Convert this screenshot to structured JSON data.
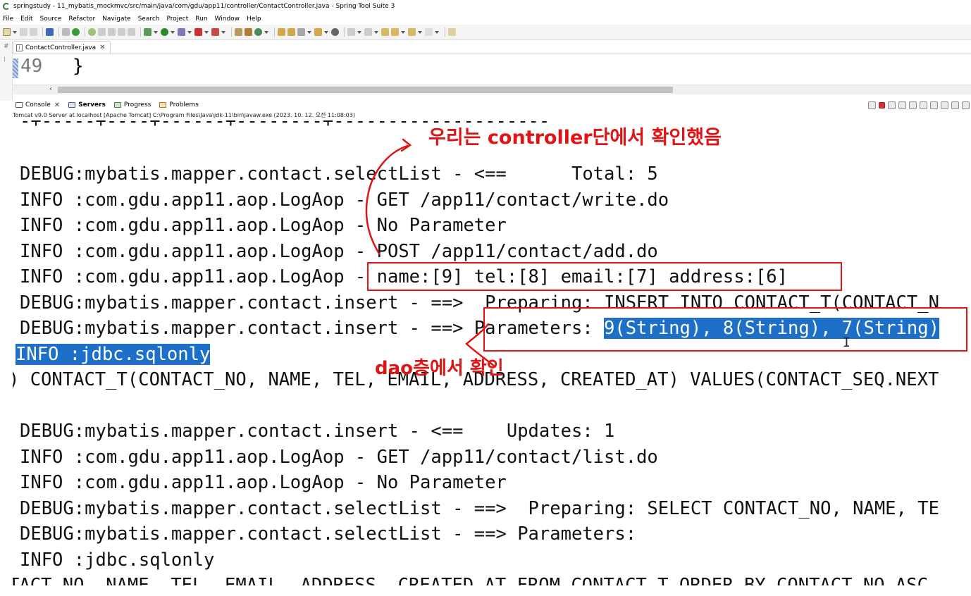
{
  "window": {
    "title": "springstudy - 11_mybatis_mockmvc/src/main/java/com/gdu/app11/controller/ContactController.java - Spring Tool Suite 3"
  },
  "menu": [
    "File",
    "Edit",
    "Source",
    "Refactor",
    "Navigate",
    "Search",
    "Project",
    "Run",
    "Window",
    "Help"
  ],
  "editor": {
    "tab_label": "ContactController.java",
    "line_number": "49",
    "code": "}"
  },
  "console": {
    "tabs": [
      {
        "label": "Console",
        "icon": "console-icon"
      },
      {
        "label": "Servers",
        "icon": "servers-icon"
      },
      {
        "label": "Progress",
        "icon": "progress-icon"
      },
      {
        "label": "Problems",
        "icon": "problems-icon"
      }
    ],
    "process_path": "Tomcat v9.0 Server at localhost [Apache Tomcat] C:\\Program Files\\Java\\jdk-11\\bin\\javaw.exe  (2023. 10. 12. 오전 11:08:03)",
    "lines": [
      "-+-----+----+------+--------+--------------------",
      "DEBUG:mybatis.mapper.contact.selectList - <==      Total: 5",
      "INFO :com.gdu.app11.aop.LogAop - GET /app11/contact/write.do",
      "INFO :com.gdu.app11.aop.LogAop - No Parameter",
      "INFO :com.gdu.app11.aop.LogAop - POST /app11/contact/add.do",
      "INFO :com.gdu.app11.aop.LogAop - name:[9] tel:[8] email:[7] address:[6]",
      "DEBUG:mybatis.mapper.contact.insert - ==>  Preparing: INSERT INTO CONTACT_T(CONTACT_N",
      "DEBUG:mybatis.mapper.contact.insert - ==> Parameters: ",
      "9(String), 8(String), 7(String)",
      "INFO :jdbc.sqlonly",
      ") CONTACT_T(CONTACT_NO, NAME, TEL, EMAIL, ADDRESS, CREATED_AT) VALUES(CONTACT_SEQ.NEXT",
      "DEBUG:mybatis.mapper.contact.insert - <==    Updates: 1",
      "INFO :com.gdu.app11.aop.LogAop - GET /app11/contact/list.do",
      "INFO :com.gdu.app11.aop.LogAop - No Parameter",
      "DEBUG:mybatis.mapper.contact.selectList - ==>  Preparing: SELECT CONTACT_NO, NAME, TE",
      "DEBUG:mybatis.mapper.contact.selectList - ==> Parameters: ",
      "INFO :jdbc.sqlonly",
      "TACT_NO, NAME, TEL, EMAIL, ADDRESS, CREATED_AT FROM CONTACT_T ORDER BY CONTACT_NO ASC"
    ]
  },
  "annotations": {
    "controller_note": "우리는 controller단에서 확인했음",
    "dao_note": "dao층에서 확인",
    "color": "#e01414"
  },
  "colors": {
    "selection": "#1e6fc8",
    "annotation": "#e01414"
  }
}
